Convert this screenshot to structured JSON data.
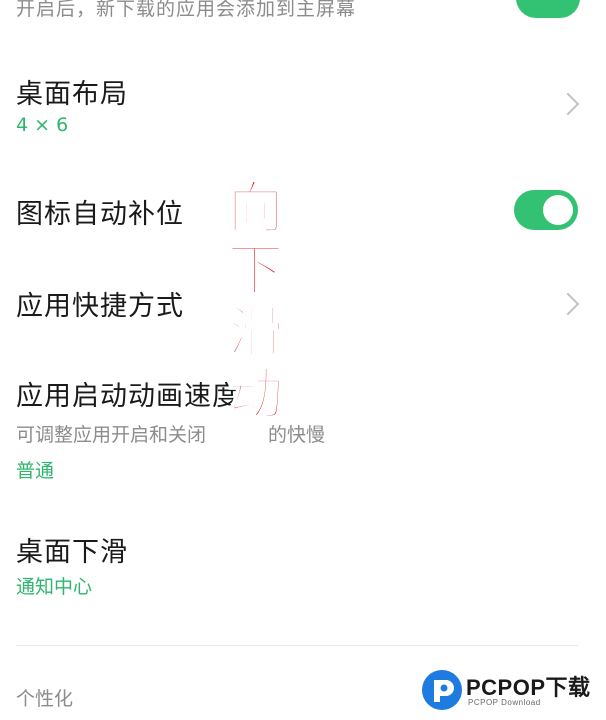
{
  "top_row": {
    "description": "开启后，新下载的应用会添加到主屏幕",
    "toggle_on": true
  },
  "settings": {
    "desktop_layout": {
      "title": "桌面布局",
      "value": "4 × 6"
    },
    "icon_auto_fill": {
      "title": "图标自动补位",
      "toggle_on": true
    },
    "app_shortcuts": {
      "title": "应用快捷方式"
    },
    "launch_animation_speed": {
      "title": "应用启动动画速度",
      "description": "可调整应用开启和关闭",
      "description_tail": "的快慢",
      "value": "普通"
    },
    "desktop_swipe_down": {
      "title": "桌面下滑",
      "value": "通知中心"
    }
  },
  "section": {
    "personalization": "个性化"
  },
  "overlay": {
    "text": "向下滑动",
    "color": "#e01b24"
  },
  "watermark": {
    "main": "PCPOP下载",
    "sub": "PCPOP Download"
  },
  "colors": {
    "accent": "#33c274",
    "value_text": "#2fb56d",
    "secondary_text": "#8c8c8c"
  },
  "icons": {
    "chevron": "chevron-right-icon",
    "toggle": "toggle-switch"
  }
}
